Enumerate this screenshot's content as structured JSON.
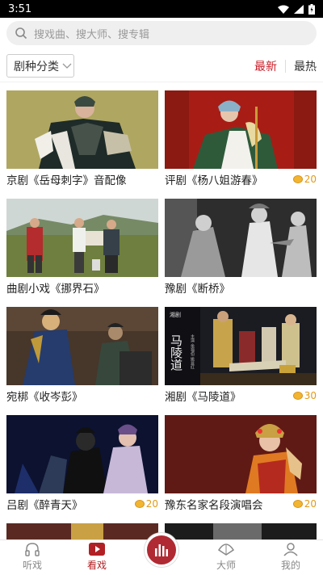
{
  "status": {
    "time": "3:51"
  },
  "search": {
    "placeholder": "搜戏曲、搜大师、搜专辑"
  },
  "filter": {
    "category_label": "剧种分类",
    "sort_latest": "最新",
    "sort_hottest": "最热"
  },
  "cards": [
    {
      "title": "京剧《岳母刺字》音配像",
      "price": ""
    },
    {
      "title": "评剧《杨八姐游春》",
      "price": "20"
    },
    {
      "title": "曲剧小戏《挪界石》",
      "price": ""
    },
    {
      "title": "豫剧《断桥》",
      "price": ""
    },
    {
      "title": "宛梆《收岑彭》",
      "price": ""
    },
    {
      "title": "湘剧《马陵道》",
      "price": "30"
    },
    {
      "title": "吕剧《醉青天》",
      "price": "20"
    },
    {
      "title": "豫东名家名段演唱会",
      "price": "20"
    }
  ],
  "thumb_text": {
    "side_title": "马陵道",
    "side_note": "主演 余福伯 姚显红",
    "corner": "湘剧",
    "caption": "曲剧小戏《挪界石》"
  },
  "tabs": [
    {
      "label": "听戏",
      "active": false
    },
    {
      "label": "看戏",
      "active": true
    },
    {
      "label": "大师",
      "active": false
    },
    {
      "label": "我的",
      "active": false
    }
  ],
  "colors": {
    "accent": "#c8202a",
    "coin": "#f2b531"
  }
}
